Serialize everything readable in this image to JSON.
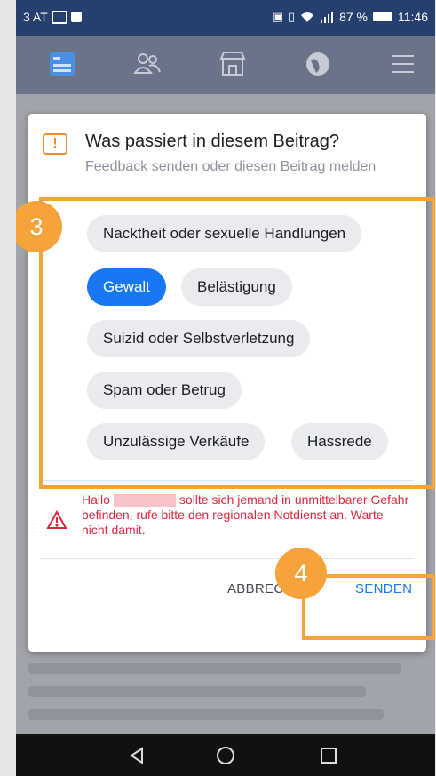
{
  "statusbar": {
    "left_text": "3 AT",
    "battery": "87 %",
    "time": "11:46"
  },
  "navbar": {
    "icons": [
      "news-feed-icon",
      "friends-icon",
      "marketplace-icon",
      "globe-icon",
      "menu-icon"
    ]
  },
  "dialog": {
    "warning_glyph": "!",
    "title": "Was passiert in diesem Beitrag?",
    "subtitle": "Feedback senden oder diesen Beitrag melden",
    "options": [
      {
        "label": "Nacktheit oder sexuelle Handlungen",
        "selected": false
      },
      {
        "label": "Gewalt",
        "selected": true
      },
      {
        "label": "Belästigung",
        "selected": false
      },
      {
        "label": "Suizid oder Selbstverletzung",
        "selected": false
      },
      {
        "label": "Spam oder Betrug",
        "selected": false
      },
      {
        "label": "Unzulässige Verkäufe",
        "selected": false
      },
      {
        "label": "Hassrede",
        "selected": false
      }
    ],
    "alert": {
      "greeting": "Hallo",
      "message": "sollte sich jemand in unmittelbarer Gefahr befinden, rufe bitte den regionalen Notdienst an. Warte nicht damit."
    },
    "cancel_label": "ABBRECHEN",
    "send_label": "SENDEN"
  },
  "annotations": {
    "step_3": "3",
    "step_4": "4"
  },
  "colors": {
    "accent": "#1877f2",
    "highlight": "#f5a33a",
    "danger": "#e0263d"
  }
}
